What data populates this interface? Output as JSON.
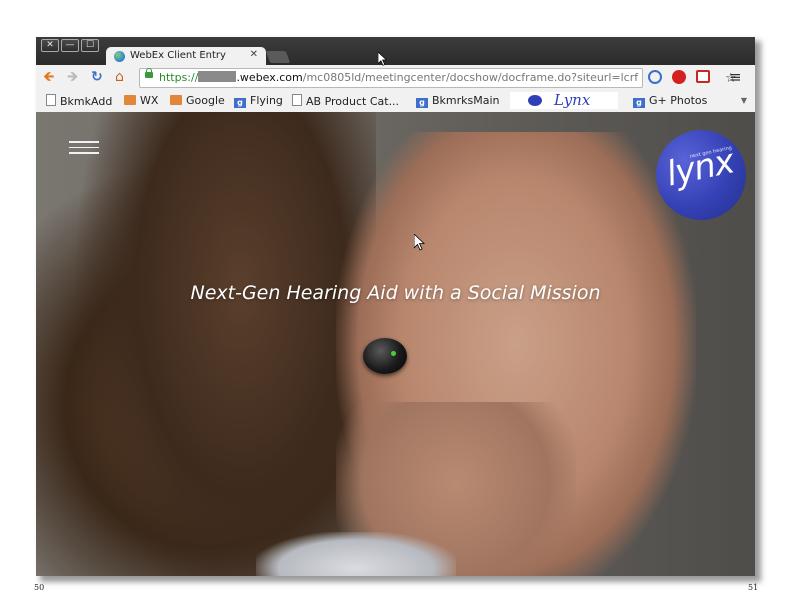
{
  "window": {
    "close": "✕",
    "minimize": "—",
    "maximize": "☐"
  },
  "tab": {
    "title": "WebEx Client Entry",
    "close": "✕"
  },
  "address": {
    "scheme": "https://",
    "host": ".webex.com",
    "path": "/mc0805ld/meetingcenter/docshow/docframe.do?siteurl=lcrf"
  },
  "bookmarks": [
    {
      "label": "BkmkAdd",
      "icon": "page-icon"
    },
    {
      "label": "WX",
      "icon": "folder-icon"
    },
    {
      "label": "Google",
      "icon": "folder-icon"
    },
    {
      "label": "Flying",
      "icon": "google-plus-icon"
    },
    {
      "label": "AB Product Cat...",
      "icon": "page-icon"
    },
    {
      "label": "BkmrksMain",
      "icon": "google-plus-icon"
    },
    {
      "label": "Lynx",
      "icon": "lynx-icon"
    },
    {
      "label": "G+ Photos",
      "icon": "google-plus-icon"
    }
  ],
  "hero": {
    "headline": "Next-Gen Hearing Aid with a Social Mission"
  },
  "logo": {
    "word": "lynx",
    "tagline": "next gen hearing",
    "color": "#3441b5"
  },
  "page_numbers": {
    "left": "50",
    "right": "51"
  }
}
